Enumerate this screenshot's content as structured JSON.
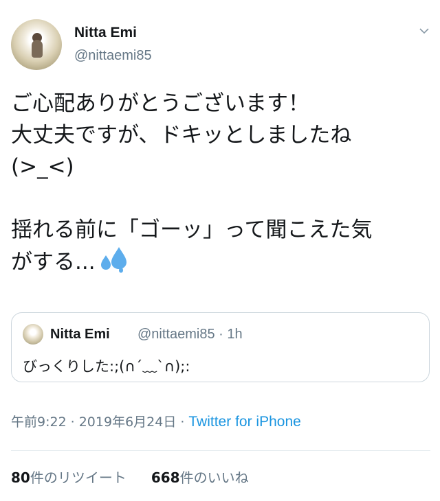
{
  "author": {
    "name": "Nitta Emi",
    "handle": "@nittaemi85"
  },
  "tweet": {
    "text": "ご心配ありがとうございます！\n大丈夫ですが、ドキッとしましたね\n(>_<)\n\n揺れる前に「ゴーッ」って聞こえた気\nがする...",
    "emoji": "sweat-droplets-icon"
  },
  "quoted_tweet": {
    "name": "Nitta Emi",
    "handle": "@nittaemi85",
    "time": "· 1h",
    "text": "びっくりした:;(∩´﹏`∩);:"
  },
  "meta": {
    "time": "午前9:22",
    "date": "2019年6月24日",
    "source": "Twitter for iPhone",
    "separator": "·"
  },
  "stats": {
    "retweets_count": "80",
    "retweets_label": "件のリツイート",
    "likes_count": "668",
    "likes_label": "件のいいね"
  },
  "colors": {
    "link": "#1b95e0",
    "secondary_text": "#657786",
    "border": "#ccd6dd"
  }
}
